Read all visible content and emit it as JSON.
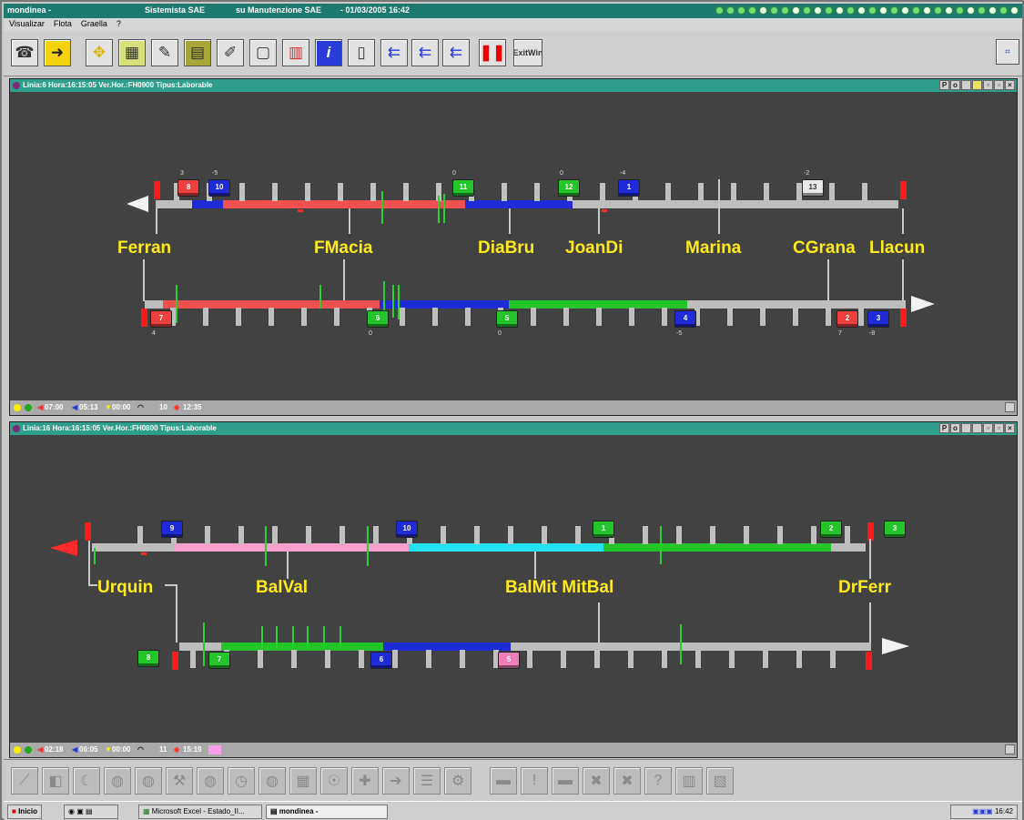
{
  "app": {
    "title": "mondinea -",
    "system": "Sistemista SAE",
    "maintenance": "su Manutenzione SAE",
    "datetime": "- 01/03/2005 16:42"
  },
  "menu": [
    "Visualizar",
    "Flota",
    "Graella",
    "?"
  ],
  "toolbar": {
    "buttons": [
      "phone-icon",
      "arrow-right-icon",
      "move-icon",
      "map-icon",
      "edit-icon",
      "calculator-icon",
      "pen-icon",
      "blank-icon",
      "chart-icon",
      "info-icon",
      "document-icon",
      "add-bus-icon",
      "ok-bus-icon",
      "remove-bus-icon",
      "pause-icon"
    ],
    "exit_label_1": "Exit",
    "exit_label_2": "Win"
  },
  "panel1": {
    "title": "Linia:6 Hora:16:15:05 Ver.Hor.:FH0900 Tipus:Laborable",
    "stops": [
      "Ferran",
      "FMacia",
      "DiaBru",
      "JoanDi",
      "Marina",
      "CGrana",
      "Llacun"
    ],
    "top_buses": [
      {
        "label": "8",
        "color": "red",
        "delta": "3"
      },
      {
        "label": "10",
        "color": "blue",
        "delta": "-5"
      },
      {
        "label": "11",
        "color": "green",
        "delta": "0"
      },
      {
        "label": "12",
        "color": "green",
        "delta": "0"
      },
      {
        "label": "1",
        "color": "blue",
        "delta": "-4"
      },
      {
        "label": "13",
        "color": "white",
        "delta": "-2"
      }
    ],
    "bottom_buses": [
      {
        "label": "7",
        "color": "red",
        "delta": "4"
      },
      {
        "label": "6",
        "color": "green",
        "delta": "0"
      },
      {
        "label": "5",
        "color": "green",
        "delta": "0"
      },
      {
        "label": "4",
        "color": "blue",
        "delta": "-5"
      },
      {
        "label": "2",
        "color": "red",
        "delta": "7"
      },
      {
        "label": "3",
        "color": "blue",
        "delta": "-8"
      }
    ],
    "status": {
      "t1": "07:00",
      "t2": "05:13",
      "t3": "00:00",
      "count": "10",
      "t4": "12:35"
    }
  },
  "panel2": {
    "title": "Linia:16 Hora:16:15:05 Ver.Hor.:FH0800 Tipus:Laborable",
    "stops": [
      "Urquin",
      "BalVal",
      "BalMit MitBal",
      "DrFerr"
    ],
    "top_buses": [
      {
        "label": "9",
        "color": "blue"
      },
      {
        "label": "10",
        "color": "blue"
      },
      {
        "label": "1",
        "color": "green"
      },
      {
        "label": "2",
        "color": "green"
      },
      {
        "label": "3",
        "color": "green"
      }
    ],
    "bottom_buses": [
      {
        "label": "8",
        "color": "green"
      },
      {
        "label": "7",
        "color": "green"
      },
      {
        "label": "6",
        "color": "blue"
      },
      {
        "label": "5",
        "color": "pink"
      }
    ],
    "status": {
      "t1": "02:18",
      "t2": "06:05",
      "t3": "00:00",
      "count": "11",
      "t4": "15:19"
    }
  },
  "bottom_toolbar": [
    "chart-line-icon",
    "brackets-icon",
    "moon-icon",
    "bus-front-icon",
    "bus-side-icon",
    "wrench-icon",
    "group-icon",
    "clock-icon",
    "lock-icon",
    "building-icon",
    "person-icon",
    "plus-circle-icon",
    "arrow-circle-icon",
    "traffic-light-icon",
    "gear-icon",
    "sms-icon",
    "alert-icon",
    "ko-icon",
    "cross-tools-icon",
    "tools-icon",
    "help-icon",
    "bars-icon",
    "photo-icon"
  ],
  "taskbar": {
    "start": "Inicio",
    "task1": "Microsoft Excel - Estado_II...",
    "task2": "mondinea -",
    "clock": "16:42"
  },
  "colors": {
    "stop_label": "#ffeb1a",
    "panel_bg": "#424242",
    "titlebar": "#2f9f8b"
  }
}
